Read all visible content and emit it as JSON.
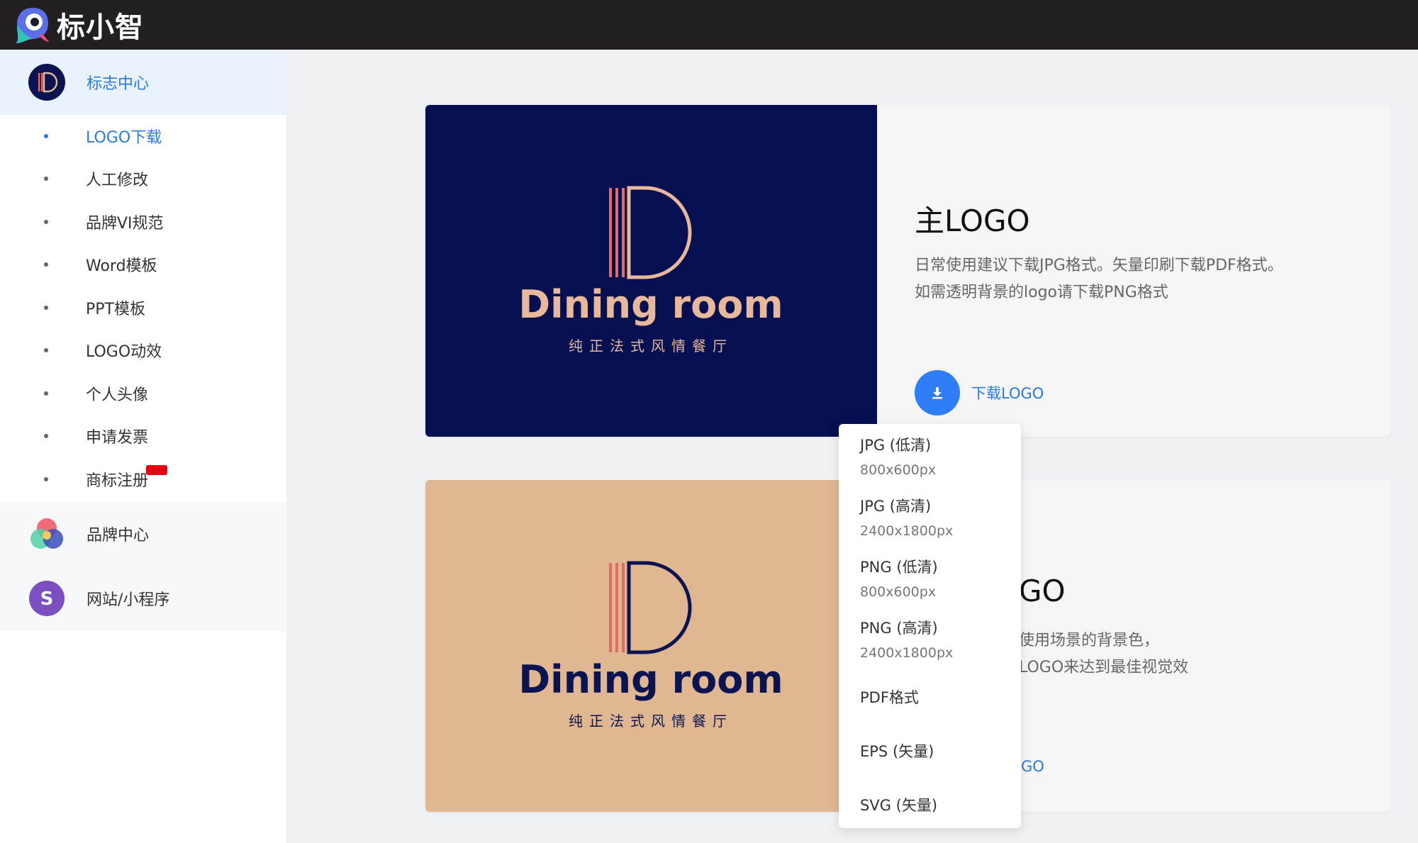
{
  "app": {
    "name": "标小智"
  },
  "sidebar": {
    "logo_center": {
      "label": "标志中心"
    },
    "sub_items": [
      {
        "label": "LOGO下载",
        "active": true
      },
      {
        "label": "人工修改"
      },
      {
        "label": "品牌VI规范"
      },
      {
        "label": "Word模板"
      },
      {
        "label": "PPT模板"
      },
      {
        "label": "LOGO动效"
      },
      {
        "label": "个人头像"
      },
      {
        "label": "申请发票"
      },
      {
        "label": "商标注册",
        "badge": "new-badge"
      }
    ],
    "brand_center": {
      "label": "品牌中心"
    },
    "website": {
      "label": "网站/小程序",
      "icon_letter": "S"
    }
  },
  "logo": {
    "name": "Dining room",
    "tagline": "纯正法式风情餐厅"
  },
  "cards": [
    {
      "title": "主LOGO",
      "desc_line1": "日常使用建议下载JPG格式。矢量印刷下载PDF格式。",
      "desc_line2": "如需透明背景的logo请下载PNG格式",
      "download_label": "下载LOGO",
      "background": "#050f52"
    },
    {
      "title": "GO",
      "desc_line1": "使用场景的背景色，",
      "desc_line2": "LOGO来达到最佳视觉效",
      "download_label": "GO",
      "background": "#e0b791"
    }
  ],
  "download_menu": [
    {
      "name": "JPG (低清)",
      "size": "800x600px"
    },
    {
      "name": "JPG (高清)",
      "size": "2400x1800px"
    },
    {
      "name": "PNG (低清)",
      "size": "800x600px"
    },
    {
      "name": "PNG (高清)",
      "size": "2400x1800px"
    },
    {
      "name": "PDF格式"
    },
    {
      "name": "EPS (矢量)"
    },
    {
      "name": "SVG (矢量)"
    }
  ],
  "colors": {
    "accent": "#2a7ae2",
    "button_blue": "#2f7df6",
    "navy": "#050f52",
    "tan": "#e0b791",
    "logo_coral": "#e06c64",
    "logo_peach": "#e8b89a"
  }
}
